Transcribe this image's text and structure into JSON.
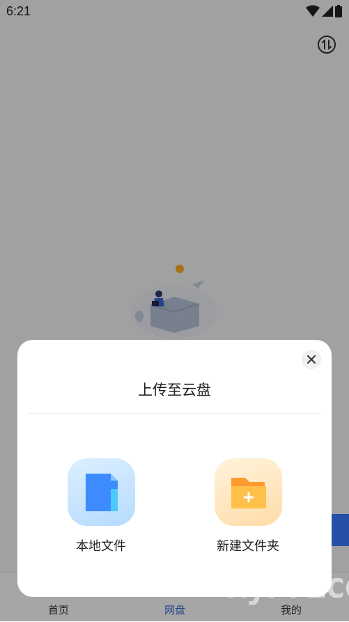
{
  "status_bar": {
    "time": "6:21",
    "icons": [
      "wifi-icon",
      "cell-signal-icon",
      "battery-icon"
    ]
  },
  "header": {
    "transfer_icon": "transfer-arrows-icon"
  },
  "bottom_nav": {
    "items": [
      {
        "label": "首页",
        "active": false
      },
      {
        "label": "网盘",
        "active": true
      },
      {
        "label": "我的",
        "active": false
      }
    ]
  },
  "upload_sheet": {
    "title": "上传至云盘",
    "close_icon": "close-icon",
    "options": [
      {
        "label": "本地文件",
        "icon": "local-file-icon",
        "color": "#3d8bff"
      },
      {
        "label": "新建文件夹",
        "icon": "new-folder-icon",
        "color": "#ffa63a"
      }
    ]
  },
  "watermark": "MyPrice",
  "colors": {
    "accent": "#3b6bd9",
    "overlay": "rgba(0,0,0,0.35)"
  }
}
